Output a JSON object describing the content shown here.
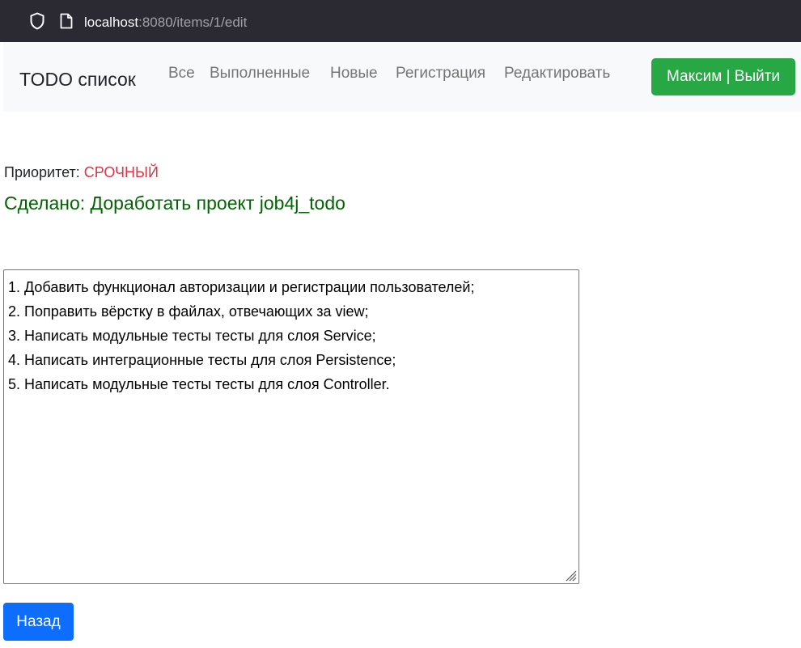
{
  "browser": {
    "url_host": "localhost",
    "url_path": ":8080/items/1/edit",
    "icons": [
      "shield-icon",
      "page-icon"
    ]
  },
  "navbar": {
    "brand": "TODO список",
    "links": [
      "Все",
      "Выполненные",
      "Новые",
      "Регистрация",
      "Редактировать"
    ],
    "user_button": "Максим | Выйти",
    "user_button_color": "#28a745"
  },
  "item": {
    "priority_label": "Приоритет:",
    "priority_value": "СРОЧНЫЙ",
    "priority_color": "#dc3545",
    "status_title": "Сделано: Доработать проект job4j_todo",
    "status_color": "#006400",
    "description_lines": [
      "1. Добавить функционал авторизации и регистрации пользователей;",
      "2. Поправить вёрстку в файлах, отвечающих за view;",
      "3. Написать модульные тесты тесты для слоя Service;",
      "4. Написать интеграционные тесты для слоя Persistence;",
      "5. Написать модульные тесты тесты для слоя Controller."
    ]
  },
  "actions": {
    "back_label": "Назад",
    "back_color": "#0d6efd"
  }
}
